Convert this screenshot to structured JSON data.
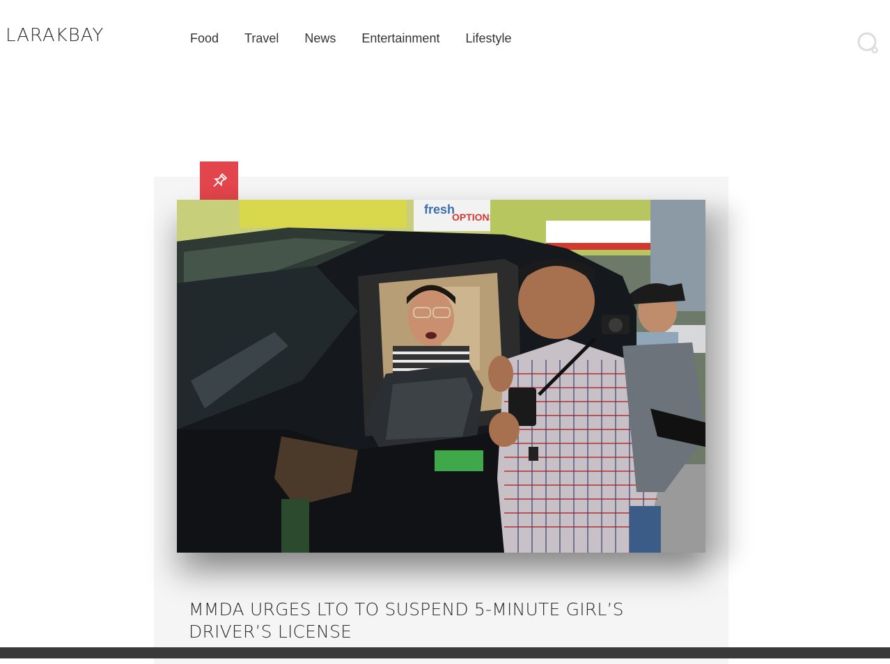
{
  "header": {
    "logo": "LARAKBAY",
    "nav": [
      "Food",
      "Travel",
      "News",
      "Entertainment",
      "Lifestyle"
    ],
    "search_icon": "search-icon"
  },
  "article": {
    "badge_icon": "pin-icon",
    "badge_color": "#e2454b",
    "image_alt": "Woman arguing from driver's seat of black van with man in checkered shirt; photographer nearby",
    "image_sign_text": "fresh OPTIONS MEATSHOP",
    "title": "MMDA URGES LTO TO SUSPEND 5-MINUTE GIRL’S DRIVER’S LICENSE"
  }
}
